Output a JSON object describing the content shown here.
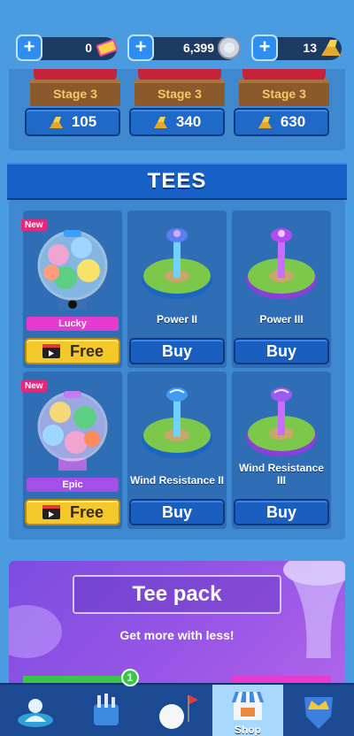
{
  "currencies": [
    {
      "value": "0",
      "icon": "ticket-icon"
    },
    {
      "value": "6,399",
      "icon": "coin-icon"
    },
    {
      "value": "13",
      "icon": "gold-bars-icon"
    }
  ],
  "stages": [
    {
      "label": "Stage 3",
      "price": "105"
    },
    {
      "label": "Stage 3",
      "price": "340"
    },
    {
      "label": "Stage 3",
      "price": "630"
    }
  ],
  "tees_header": "TEES",
  "tees": [
    {
      "type": "box",
      "badge": "New",
      "rarity": "Lucky",
      "button": "Free"
    },
    {
      "type": "tee",
      "name": "Power II",
      "button": "Buy"
    },
    {
      "type": "tee",
      "name": "Power III",
      "button": "Buy"
    },
    {
      "type": "box",
      "badge": "New",
      "rarity": "Epic",
      "button": "Free"
    },
    {
      "type": "tee",
      "name": "Wind Resistance II",
      "button": "Buy"
    },
    {
      "type": "tee",
      "name": "Wind Resistance III",
      "button": "Buy"
    }
  ],
  "pack": {
    "title": "Tee pack",
    "subtitle": "Get more with less!"
  },
  "nav": {
    "notification": "1",
    "items": [
      {
        "icon": "avatar-icon",
        "label": ""
      },
      {
        "icon": "golf-bag-icon",
        "label": ""
      },
      {
        "icon": "golf-ball-flag-icon",
        "label": ""
      },
      {
        "icon": "shop-icon",
        "label": "Shop"
      },
      {
        "icon": "crown-shield-icon",
        "label": ""
      }
    ]
  },
  "colors": {
    "background": "#4a9be0",
    "panel": "#3d88cf",
    "card": "#2f6eb4",
    "button": "#1a5fc0",
    "free": "#f3c82a",
    "pack": "#9a56e6"
  }
}
